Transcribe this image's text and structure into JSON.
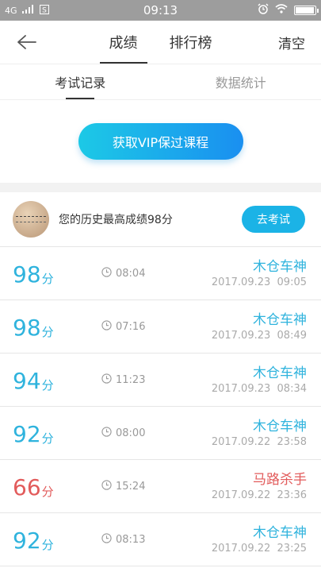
{
  "status": {
    "network": "4G",
    "time": "09:13",
    "battery_level": 0.95
  },
  "header": {
    "tabs": [
      {
        "label": "成绩",
        "active": true
      },
      {
        "label": "排行榜",
        "active": false
      }
    ],
    "clear_label": "清空"
  },
  "subtabs": [
    {
      "label": "考试记录",
      "active": true
    },
    {
      "label": "数据统计",
      "active": false
    }
  ],
  "vip_button": "获取VIP保过课程",
  "best": {
    "text": "您的历史最高成绩98分",
    "button": "去考试"
  },
  "score_unit": "分",
  "records": [
    {
      "score": "98",
      "duration": "08:04",
      "title": "木仓车神",
      "date": "2017.09.23",
      "time": "09:05",
      "fail": false
    },
    {
      "score": "98",
      "duration": "07:16",
      "title": "木仓车神",
      "date": "2017.09.23",
      "time": "08:49",
      "fail": false
    },
    {
      "score": "94",
      "duration": "11:23",
      "title": "木仓车神",
      "date": "2017.09.23",
      "time": "08:34",
      "fail": false
    },
    {
      "score": "92",
      "duration": "08:00",
      "title": "木仓车神",
      "date": "2017.09.22",
      "time": "23:58",
      "fail": false
    },
    {
      "score": "66",
      "duration": "15:24",
      "title": "马路杀手",
      "date": "2017.09.22",
      "time": "23:36",
      "fail": true
    },
    {
      "score": "92",
      "duration": "08:13",
      "title": "木仓车神",
      "date": "2017.09.22",
      "time": "23:25",
      "fail": false
    }
  ]
}
